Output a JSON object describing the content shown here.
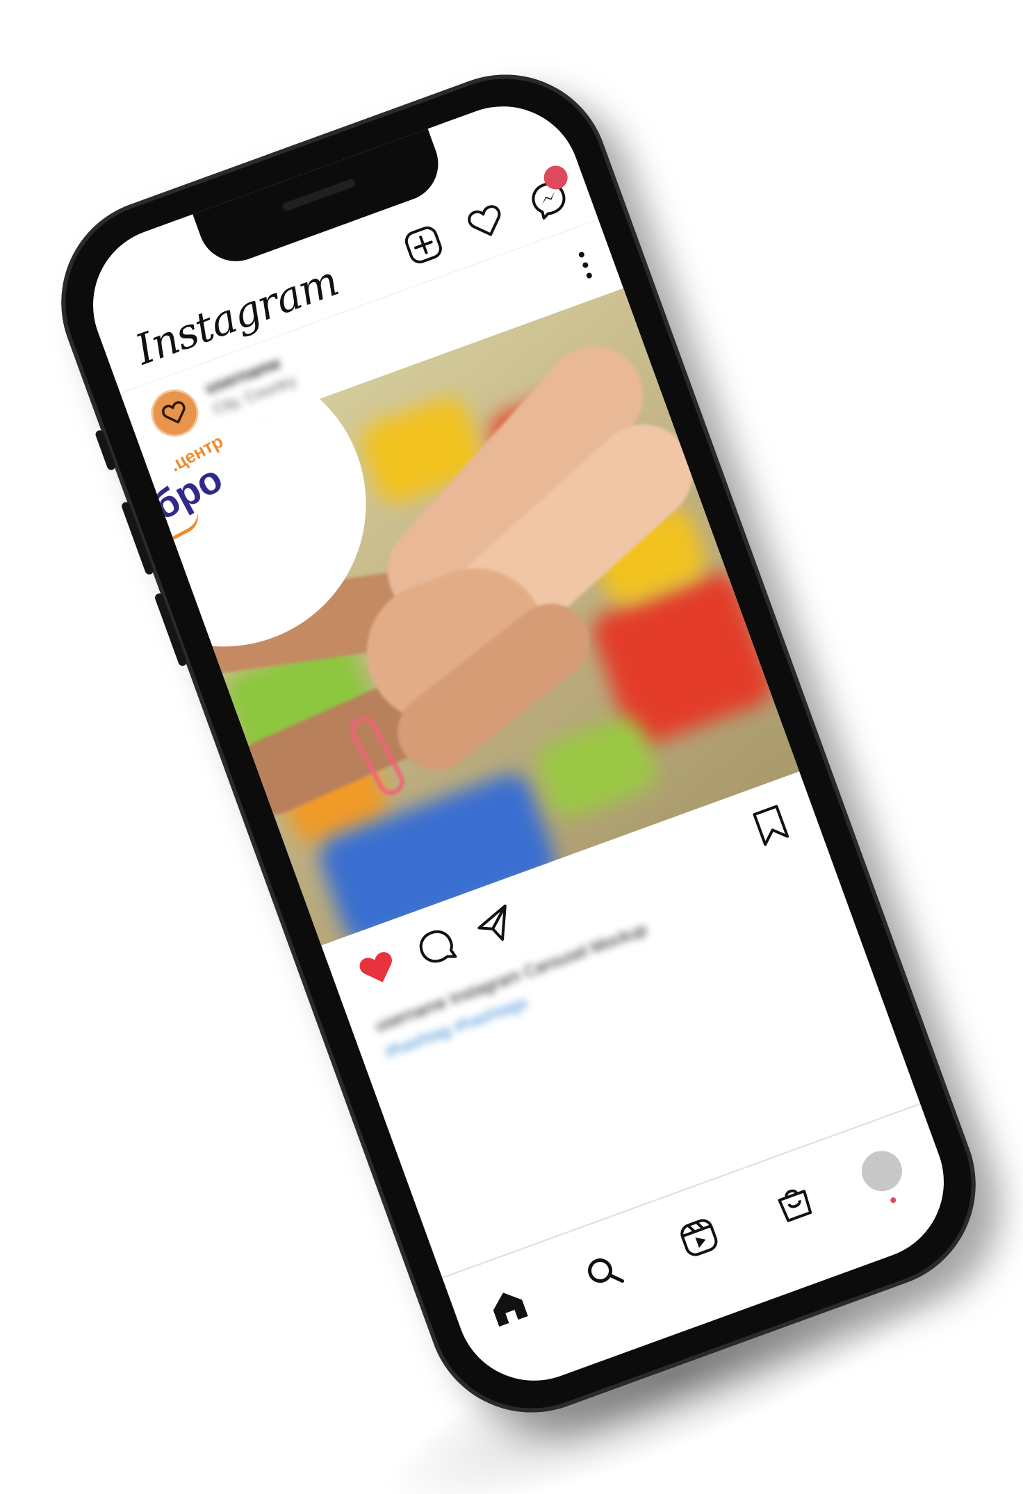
{
  "app": {
    "logo_text": "Instagram"
  },
  "post": {
    "username": "username",
    "location": "City, Country",
    "brand_small": ".центр",
    "brand_big": "добро",
    "caption_line": "username Instagram Carousel Mockup",
    "caption_tags": "#hashtag #hashtags",
    "liked": true
  },
  "colors": {
    "like_red": "#e8333f",
    "badge_red": "#e0485b",
    "avatar_orange": "#e8944b",
    "brand_orange": "#f08a2e",
    "brand_purple": "#2f2a8a",
    "hashtag_blue": "#3d8fd6"
  },
  "icons": {
    "top_bar": [
      "new-post-icon",
      "activity-heart-icon",
      "messenger-icon"
    ],
    "actions": [
      "like-heart-icon",
      "comment-icon",
      "share-icon",
      "save-bookmark-icon"
    ],
    "bottom_nav": [
      "home-icon",
      "search-icon",
      "reels-icon",
      "shop-icon",
      "profile-avatar"
    ]
  }
}
